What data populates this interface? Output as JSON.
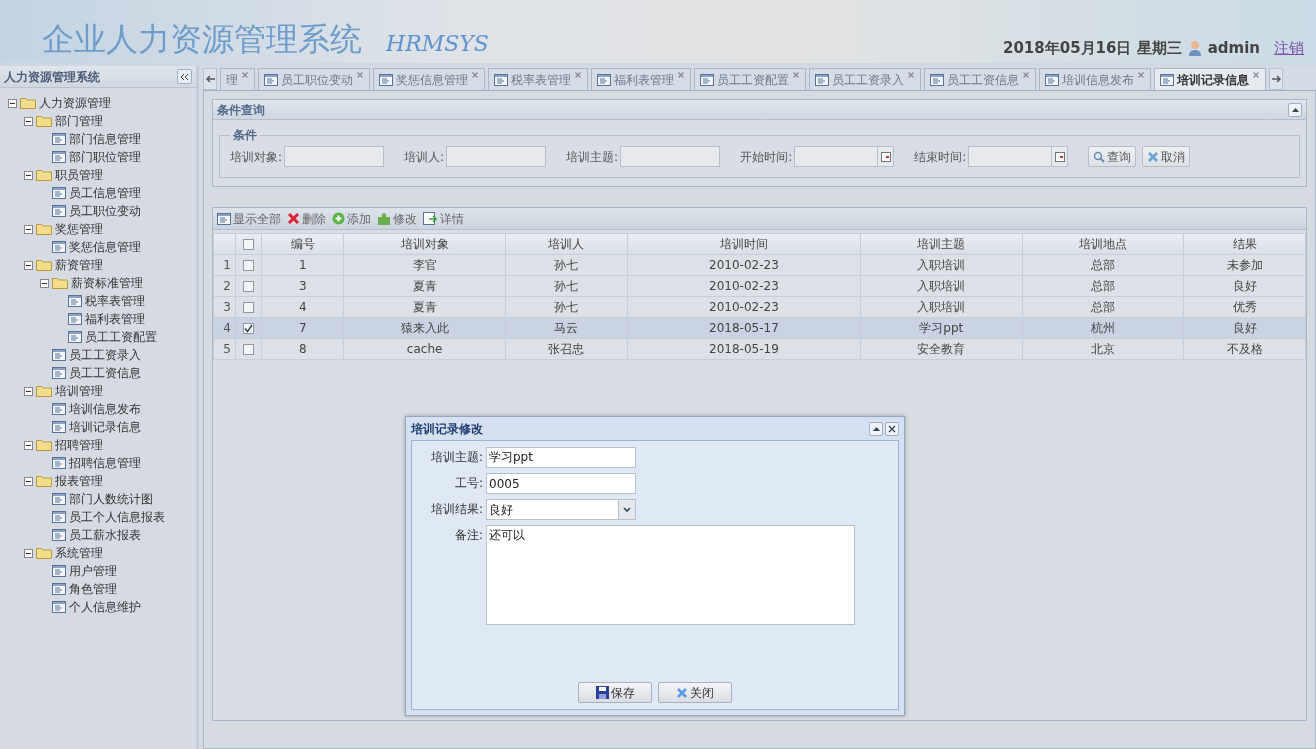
{
  "header": {
    "title": "企业人力资源管理系统",
    "subtitle": "HRMSYS",
    "date": "2018年05月16日 星期三",
    "user": "admin",
    "logout": "注销"
  },
  "sidebar": {
    "title": "人力资源管理系统",
    "tree": [
      {
        "label": "人力资源管理",
        "expanded": true,
        "children": [
          {
            "label": "部门管理",
            "expanded": true,
            "children": [
              {
                "label": "部门信息管理"
              },
              {
                "label": "部门职位管理"
              }
            ]
          },
          {
            "label": "职员管理",
            "expanded": true,
            "children": [
              {
                "label": "员工信息管理"
              },
              {
                "label": "员工职位变动"
              }
            ]
          },
          {
            "label": "奖惩管理",
            "expanded": true,
            "children": [
              {
                "label": "奖惩信息管理"
              }
            ]
          },
          {
            "label": "薪资管理",
            "expanded": true,
            "children": [
              {
                "label": "薪资标准管理",
                "expanded": true,
                "children": [
                  {
                    "label": "税率表管理"
                  },
                  {
                    "label": "福利表管理"
                  },
                  {
                    "label": "员工工资配置"
                  }
                ]
              },
              {
                "label": "员工工资录入"
              },
              {
                "label": "员工工资信息"
              }
            ]
          },
          {
            "label": "培训管理",
            "expanded": true,
            "children": [
              {
                "label": "培训信息发布"
              },
              {
                "label": "培训记录信息"
              }
            ]
          },
          {
            "label": "招聘管理",
            "expanded": true,
            "children": [
              {
                "label": "招聘信息管理"
              }
            ]
          },
          {
            "label": "报表管理",
            "expanded": true,
            "children": [
              {
                "label": "部门人数统计图"
              },
              {
                "label": "员工个人信息报表"
              },
              {
                "label": "员工薪水报表"
              }
            ]
          },
          {
            "label": "系统管理",
            "expanded": true,
            "children": [
              {
                "label": "用户管理"
              },
              {
                "label": "角色管理"
              },
              {
                "label": "个人信息维护"
              }
            ]
          }
        ]
      }
    ]
  },
  "tabs": [
    {
      "label": "理",
      "selected": false
    },
    {
      "label": "员工职位变动",
      "selected": false
    },
    {
      "label": "奖惩信息管理",
      "selected": false
    },
    {
      "label": "税率表管理",
      "selected": false
    },
    {
      "label": "福利表管理",
      "selected": false
    },
    {
      "label": "员工工资配置",
      "selected": false
    },
    {
      "label": "员工工资录入",
      "selected": false
    },
    {
      "label": "员工工资信息",
      "selected": false
    },
    {
      "label": "培训信息发布",
      "selected": false
    },
    {
      "label": "培训记录信息",
      "selected": true
    }
  ],
  "query_panel": {
    "title": "条件查询",
    "legend": "条件",
    "fields": [
      {
        "label": "培训对象:",
        "kind": "text"
      },
      {
        "label": "培训人:",
        "kind": "text"
      },
      {
        "label": "培训主题:",
        "kind": "text"
      },
      {
        "label": "开始时间:",
        "kind": "date"
      },
      {
        "label": "结束时间:",
        "kind": "date"
      }
    ],
    "buttons": [
      "查询",
      "取消"
    ]
  },
  "toolbar": [
    "显示全部",
    "删除",
    "添加",
    "修改",
    "详情"
  ],
  "table": {
    "all_checked": false,
    "columns": [
      "编号",
      "培训对象",
      "培训人",
      "培训时间",
      "培训主题",
      "培训地点",
      "结果"
    ],
    "rows": [
      {
        "number": "1",
        "checked": false,
        "selected": false,
        "cells": [
          "1",
          "李官",
          "孙七",
          "2010-02-23",
          "入职培训",
          "总部",
          "未参加"
        ]
      },
      {
        "number": "2",
        "checked": false,
        "selected": false,
        "cells": [
          "3",
          "夏青",
          "孙七",
          "2010-02-23",
          "入职培训",
          "总部",
          "良好"
        ]
      },
      {
        "number": "3",
        "checked": false,
        "selected": false,
        "cells": [
          "4",
          "夏青",
          "孙七",
          "2010-02-23",
          "入职培训",
          "总部",
          "优秀"
        ]
      },
      {
        "number": "4",
        "checked": true,
        "selected": true,
        "cells": [
          "7",
          "猿来入此",
          "马云",
          "2018-05-17",
          "学习ppt",
          "杭州",
          "良好"
        ]
      },
      {
        "number": "5",
        "checked": false,
        "selected": false,
        "cells": [
          "8",
          "cache",
          "张召忠",
          "2018-05-19",
          "安全教育",
          "北京",
          "不及格"
        ]
      }
    ]
  },
  "dialog": {
    "title": "培训记录修改",
    "fields": [
      {
        "label": "培训主题:",
        "kind": "text",
        "value": "学习ppt"
      },
      {
        "label": "工号:",
        "kind": "text",
        "value": "0005"
      },
      {
        "label": "培训结果:",
        "kind": "select",
        "value": "良好"
      },
      {
        "label": "备注:",
        "kind": "textarea",
        "value": "还可以"
      }
    ],
    "buttons": [
      "保存",
      "关闭"
    ]
  }
}
